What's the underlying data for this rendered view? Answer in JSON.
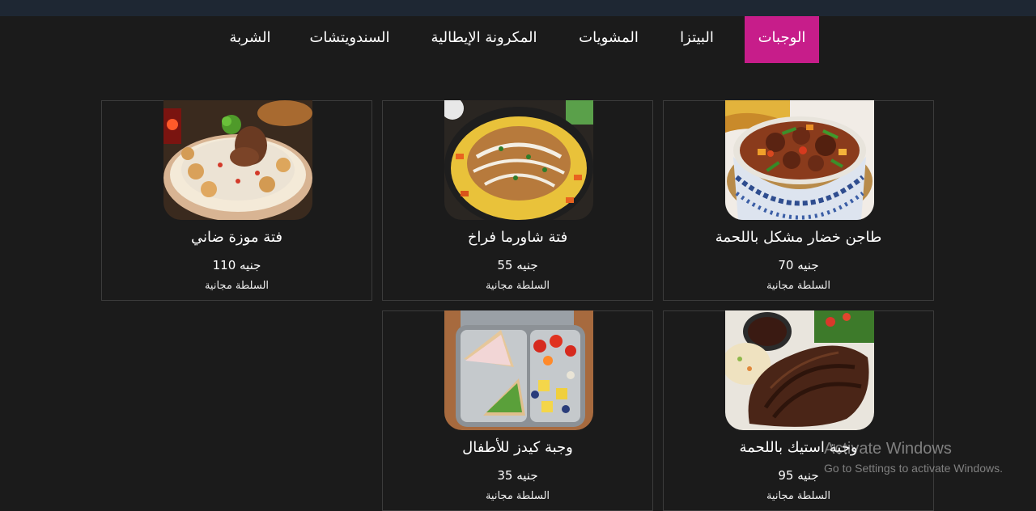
{
  "nav": {
    "items": [
      {
        "label": "الوجبات",
        "active": true
      },
      {
        "label": "البيتزا",
        "active": false
      },
      {
        "label": "المشويات",
        "active": false
      },
      {
        "label": "المكرونة الإيطالية",
        "active": false
      },
      {
        "label": "السندويتشات",
        "active": false
      },
      {
        "label": "الشربة",
        "active": false
      }
    ]
  },
  "colors": {
    "accent": "#c71d8a",
    "background": "#1b1b1b",
    "topbar": "#1e2733",
    "card_border": "#3c3c3c"
  },
  "meals": [
    {
      "name": "طاجن خضار مشكل باللحمة",
      "price": "70 جنيه",
      "note": "السلطة مجانية",
      "image": "vegetable-tagine-image"
    },
    {
      "name": "فتة شاورما فراخ",
      "price": "55 جنيه",
      "note": "السلطة مجانية",
      "image": "shawarma-fatta-image"
    },
    {
      "name": "فتة موزة ضاني",
      "price": "110 جنيه",
      "note": "السلطة مجانية",
      "image": "lamb-shank-fatta-image"
    },
    {
      "name": "وجبة استيك باللحمة",
      "price": "95 جنيه",
      "note": "السلطة مجانية",
      "image": "steak-meal-image"
    },
    {
      "name": "وجبة كيدز للأطفال",
      "price": "35 جنيه",
      "note": "السلطة مجانية",
      "image": "kids-meal-image"
    }
  ],
  "watermark": {
    "title": "Activate Windows",
    "subtitle": "Go to Settings to activate Windows."
  }
}
